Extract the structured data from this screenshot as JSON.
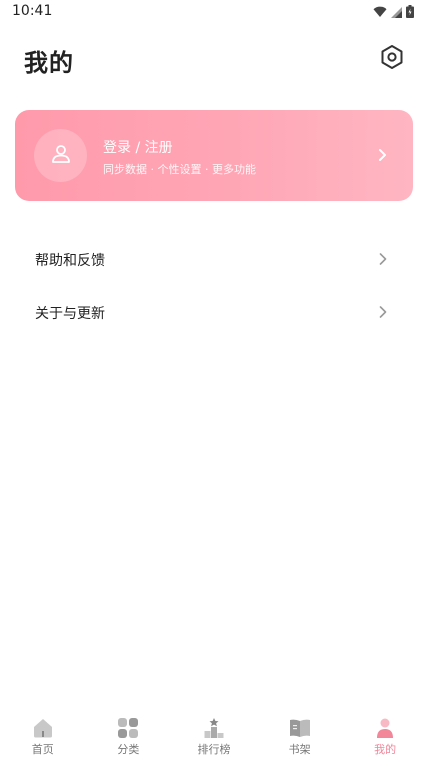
{
  "status_bar": {
    "time": "10:41",
    "icons": [
      "wifi-icon",
      "signal-icon",
      "battery-icon"
    ]
  },
  "header": {
    "title": "我的",
    "settings_icon": "settings-icon"
  },
  "login_card": {
    "title": "登录 / 注册",
    "subtitle": "同步数据 · 个性设置 · 更多功能",
    "icon": "user-icon",
    "accent_color": "#ff9aab"
  },
  "menu": {
    "items": [
      {
        "label": "帮助和反馈"
      },
      {
        "label": "关于与更新"
      }
    ]
  },
  "bottom_nav": {
    "active_index": 4,
    "active_color": "#f2879a",
    "items": [
      {
        "label": "首页",
        "icon": "home-icon"
      },
      {
        "label": "分类",
        "icon": "category-icon"
      },
      {
        "label": "排行榜",
        "icon": "ranking-icon"
      },
      {
        "label": "书架",
        "icon": "bookshelf-icon"
      },
      {
        "label": "我的",
        "icon": "profile-icon"
      }
    ]
  }
}
